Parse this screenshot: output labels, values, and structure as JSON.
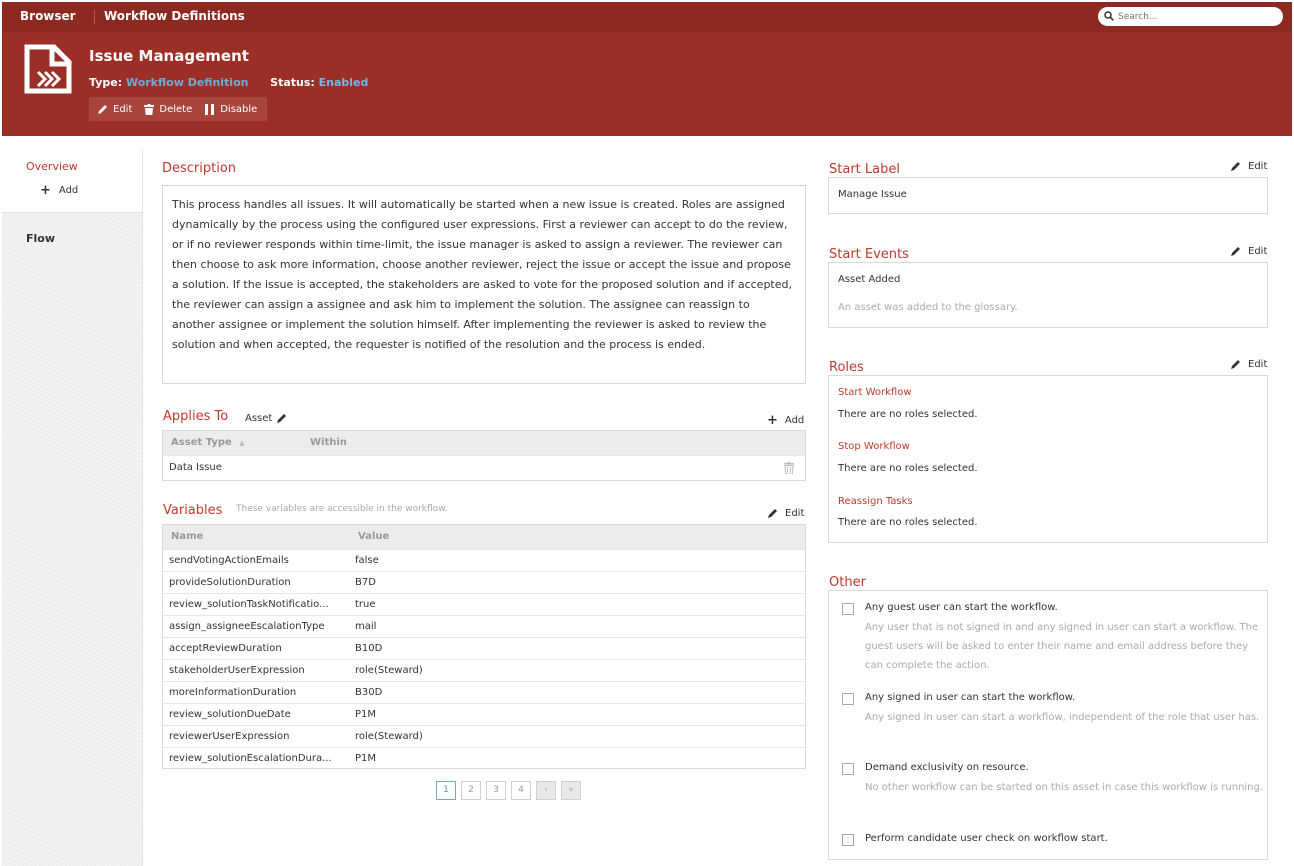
{
  "topbar": {
    "brand": "Browser",
    "breadcrumb": "Workflow Definitions",
    "search_placeholder": "Search..."
  },
  "header": {
    "title": "Issue Management",
    "type_label": "Type:",
    "type_value": "Workflow Definition",
    "status_label": "Status:",
    "status_value": "Enabled",
    "actions": {
      "edit": "Edit",
      "delete": "Delete",
      "disable": "Disable"
    }
  },
  "sidebar": {
    "overview": "Overview",
    "add": "Add",
    "flow": "Flow"
  },
  "description": {
    "title": "Description",
    "text": "This process handles all issues. It will automatically be started when a new issue is created. Roles are assigned dynamically by the process using the configured user expressions. First a reviewer can accept to do the review, or if no reviewer responds within time-limit, the issue manager is asked to assign a reviewer. The reviewer can then choose to ask more information, choose another reviewer, reject the issue or accept the issue and propose a solution. If the issue is accepted, the stakeholders are asked to vote for the proposed solution and if accepted, the reviewer can assign a assignee and ask him to implement the solution. The assignee can reassign to another assignee or implement the solution himself. After implementing the reviewer is asked to review the solution and when accepted, the requester is notified of the resolution and the process is ended."
  },
  "applies_to": {
    "title": "Applies To",
    "asset_link": "Asset",
    "add": "Add",
    "columns": [
      "Asset Type",
      "Within"
    ],
    "rows": [
      {
        "asset_type": "Data Issue",
        "within": ""
      }
    ]
  },
  "variables": {
    "title": "Variables",
    "hint": "These variables are accessible in the workflow.",
    "edit": "Edit",
    "columns": [
      "Name",
      "Value"
    ],
    "rows": [
      {
        "name": "sendVotingActionEmails",
        "value": "false"
      },
      {
        "name": "provideSolutionDuration",
        "value": "B7D"
      },
      {
        "name": "review_solutionTaskNotificatio...",
        "value": "true"
      },
      {
        "name": "assign_assigneeEscalationType",
        "value": "mail"
      },
      {
        "name": "acceptReviewDuration",
        "value": "B10D"
      },
      {
        "name": "stakeholderUserExpression",
        "value": "role(Steward)"
      },
      {
        "name": "moreInformationDuration",
        "value": "B30D"
      },
      {
        "name": "review_solutionDueDate",
        "value": "P1M"
      },
      {
        "name": "reviewerUserExpression",
        "value": "role(Steward)"
      },
      {
        "name": "review_solutionEscalationDura...",
        "value": "P1M"
      }
    ],
    "pages": [
      "1",
      "2",
      "3",
      "4"
    ],
    "current_page": 1
  },
  "start_label": {
    "title": "Start Label",
    "edit": "Edit",
    "value": "Manage Issue"
  },
  "start_events": {
    "title": "Start Events",
    "edit": "Edit",
    "event": "Asset Added",
    "event_desc": "An asset was added to the glossary."
  },
  "roles": {
    "title": "Roles",
    "edit": "Edit",
    "items": [
      {
        "label": "Start Workflow",
        "value": "There are no roles selected."
      },
      {
        "label": "Stop Workflow",
        "value": "There are no roles selected."
      },
      {
        "label": "Reassign Tasks",
        "value": "There are no roles selected."
      }
    ]
  },
  "other": {
    "title": "Other",
    "options": [
      {
        "label": "Any guest user can start the workflow.",
        "desc": "Any user that is not signed in and any signed in user can start a workflow. The guest users will be asked to enter their name and email address before they can complete the action.",
        "checked": false
      },
      {
        "label": "Any signed in user can start the workflow.",
        "desc": "Any signed in user can start a workflow, independent of the role that user has.",
        "checked": false
      },
      {
        "label": "Demand exclusivity on resource.",
        "desc": "No other workflow can be started on this asset in case this workflow is running.",
        "checked": false
      },
      {
        "label": "Perform candidate user check on workflow start.",
        "desc": "",
        "checked": false
      }
    ]
  },
  "colors": {
    "topbar": "#8c2a22",
    "header": "#9b2f27",
    "accent": "#c0392b",
    "link": "#6fa9d6"
  }
}
